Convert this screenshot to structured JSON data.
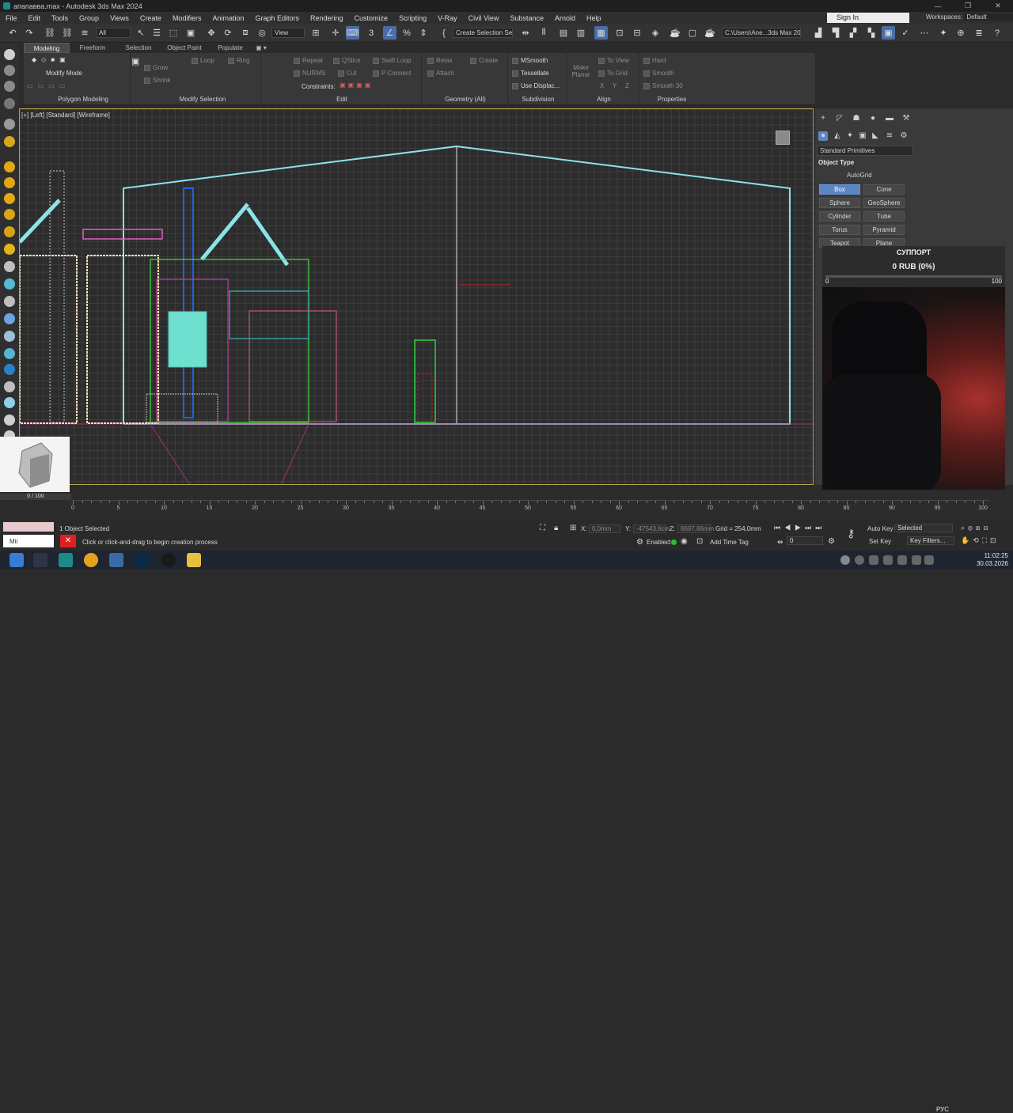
{
  "window": {
    "title": "апапавва.max - Autodesk 3ds Max 2024",
    "controls": [
      "—",
      "❐",
      "✕"
    ]
  },
  "menu": [
    "File",
    "Edit",
    "Tools",
    "Group",
    "Views",
    "Create",
    "Modifiers",
    "Animation",
    "Graph Editors",
    "Rendering",
    "Customize",
    "Scripting",
    "V-Ray",
    "Civil View",
    "Substance",
    "Arnold",
    "Help"
  ],
  "account": {
    "signin": "Sign In",
    "workspaces_label": "Workspaces:",
    "workspace": "Default"
  },
  "toolbar": {
    "filter": "All",
    "refcoord": "View",
    "selection_set": "Create Selection Se",
    "path": "C:\\Users\\Ane...3ds Max 2024"
  },
  "ribbon": {
    "tabs": [
      "Modeling",
      "Freeform",
      "Selection",
      "Object Paint",
      "Populate"
    ],
    "modify_mode": "Modify Mode",
    "panels": {
      "polygon_modeling": "Polygon Modeling",
      "modify_selection": "Modify Selection",
      "edit": "Edit",
      "geometry": "Geometry (All)",
      "subdivision": "Subdivision",
      "align": "Align",
      "properties": "Properties"
    },
    "buttons": {
      "grow": "Grow",
      "shrink": "Shrink",
      "loop": "Loop",
      "ring": "Ring",
      "repeat": "Repeat",
      "qslice": "QSlice",
      "swift_loop": "Swift Loop",
      "nurms": "NURMS",
      "cut": "Cut",
      "pconnect": "P Connect",
      "constraints": "Constraints:",
      "relax": "Relax",
      "create": "Create",
      "attach": "Attach",
      "msmooth": "MSmooth",
      "tessellate": "Tessellate",
      "use_displac": "Use Displac...",
      "make_planar": "Make Planar",
      "to_view": "To View",
      "to_grid": "To Grid",
      "hard": "Hard",
      "smooth": "Smooth",
      "smooth30": "Smooth 30",
      "x": "X",
      "y": "Y",
      "z": "Z"
    }
  },
  "viewport": {
    "label": "[+] [Left] [Standard] [Wireframe]"
  },
  "command_panel": {
    "category": "Standard Primitives",
    "object_type": "Object Type",
    "autogrid": "AutoGrid",
    "primitives": [
      "Box",
      "Cone",
      "Sphere",
      "GeoSphere",
      "Cylinder",
      "Tube",
      "Torus",
      "Pyramid",
      "Teapot",
      "Plane"
    ],
    "selected": "Box"
  },
  "support_widget": {
    "title": "СУППОРТ",
    "amount": "0 RUB (0%)",
    "min": "0",
    "max": "100",
    "progress": 0
  },
  "timeline": {
    "slider": "0 / 100",
    "ticks": [
      "0",
      "5",
      "10",
      "15",
      "20",
      "25",
      "30",
      "35",
      "40",
      "45",
      "50",
      "55",
      "60",
      "65",
      "70",
      "75",
      "80",
      "85",
      "90",
      "95",
      "100"
    ]
  },
  "status": {
    "selected": "1 Object Selected",
    "prompt": "Click or click-and-drag to begin creation process",
    "x_label": "X:",
    "x": "0,0mm",
    "y_label": "Y:",
    "y": "-47543,6cm",
    "z_label": "Z:",
    "z": "8697,86mm",
    "grid": "Grid = 254,0mm",
    "enabled": "Enabled:",
    "add_time_tag": "Add Time Tag",
    "auto_key": "Auto Key",
    "set_key": "Set Key",
    "key_filter": "Selected",
    "key_filters": "Key Filters...",
    "frame": "0",
    "maxscript": "Mii"
  },
  "taskbar": {
    "lang": "РУС",
    "time": "11:02:25",
    "date": "30.03.2026"
  },
  "colors": {
    "accent": "#5b86c4",
    "viewport_border": "#b5a54a",
    "wire_cyan": "#8be3e8",
    "support_fill": "#2fa84f"
  }
}
